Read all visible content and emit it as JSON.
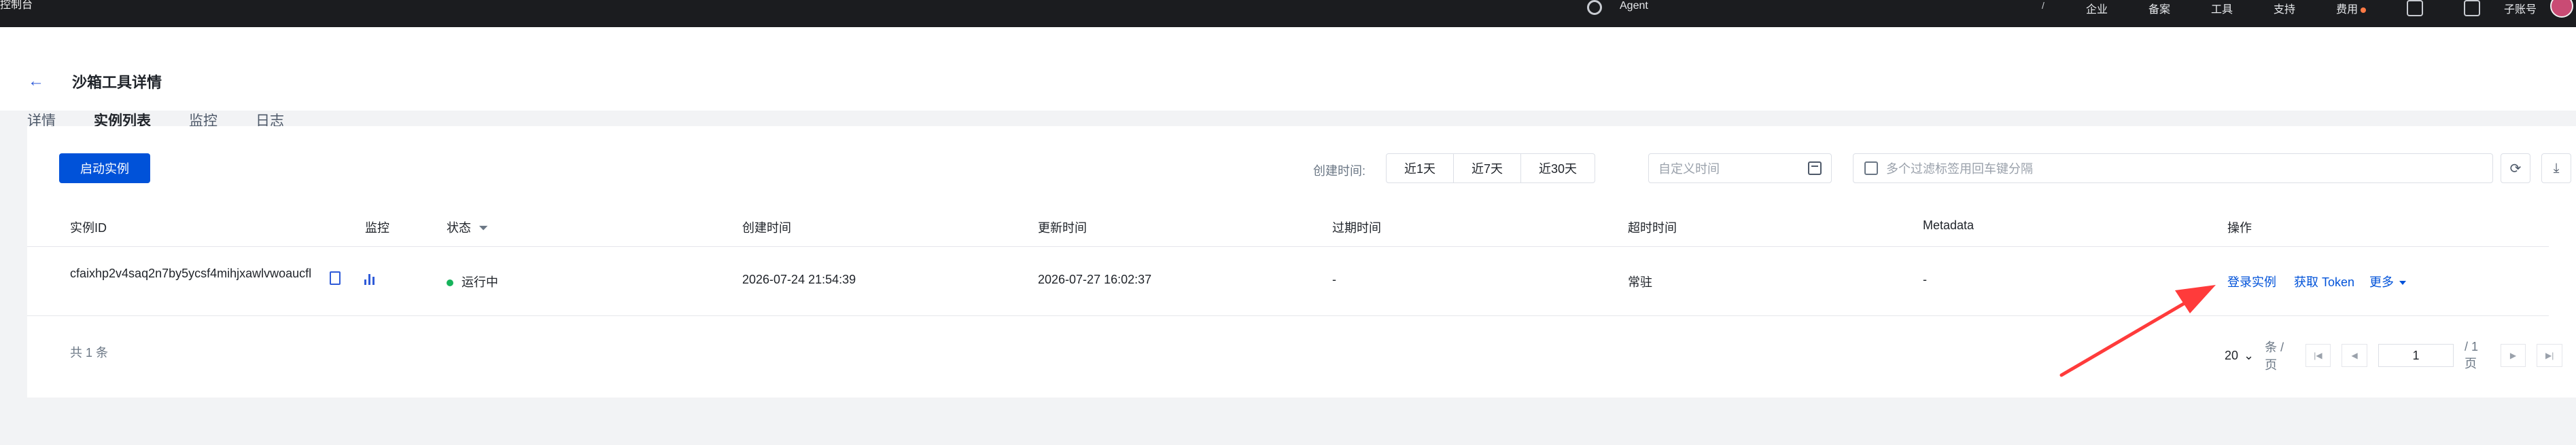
{
  "topbar": {
    "brand": "控制台",
    "search": "Agent",
    "slash": "/",
    "menu": [
      "企业",
      "备案",
      "工具",
      "支持",
      "费用"
    ],
    "subaccount": "子账号"
  },
  "header": {
    "back": "←",
    "title": "沙箱工具详情",
    "tabs": [
      "详情",
      "实例列表",
      "监控",
      "日志"
    ]
  },
  "toolbar": {
    "start_button": "启动实例",
    "created_time_label": "创建时间:",
    "segments": [
      "近1天",
      "近7天",
      "近30天"
    ],
    "date_placeholder": "自定义时间",
    "filter_placeholder": "多个过滤标签用回车键分隔"
  },
  "table": {
    "columns": [
      "实例ID",
      "监控",
      "状态",
      "创建时间",
      "更新时间",
      "过期时间",
      "超时时间",
      "Metadata",
      "操作"
    ],
    "rows": [
      {
        "id": "cfaixhp2v4saq2n7by5ycsf4mihjxawlvwoaucfl",
        "status": "运行中",
        "created": "2026-07-24 21:54:39",
        "updated": "2026-07-27 16:02:37",
        "expire": "-",
        "timeout": "常驻",
        "metadata": "-",
        "actions": [
          "登录实例",
          "获取 Token",
          "更多"
        ]
      }
    ]
  },
  "footer": {
    "total": "共 1 条",
    "page_size": "20",
    "per_page": "条 / 页",
    "page": "1",
    "page_total": "/ 1 页"
  }
}
